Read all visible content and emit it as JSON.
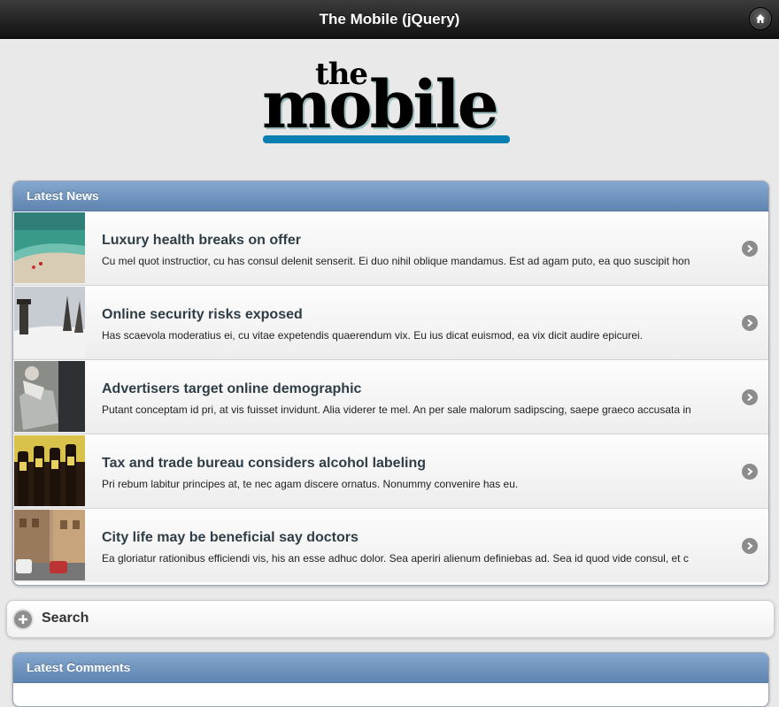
{
  "header": {
    "title": "The Mobile (jQuery)",
    "home_icon": "home-icon"
  },
  "logo": {
    "the": "the",
    "mobile": "mobile",
    "accent": "#0a7fb2"
  },
  "latest_news": {
    "heading": "Latest News",
    "items": [
      {
        "title": "Luxury health breaks on offer",
        "desc": "Cu mel quot instructior, cu has consul delenit senserit. Ei duo nihil oblique mandamus. Est ad agam puto, ea quo suscipit hon",
        "thumb": "beach-thumbnail"
      },
      {
        "title": "Online security risks exposed",
        "desc": "Has scaevola moderatius ei, cu vitae expetendis quaerendum vix. Eu ius dicat euismod, ea vix dicit audire epicurei.",
        "thumb": "snow-tower-thumbnail"
      },
      {
        "title": "Advertisers target online demographic",
        "desc": "Putant conceptam id pri, at vis fuisset invidunt. Alia viderer te mel. An per sale malorum sadipscing, saepe graeco accusata in",
        "thumb": "sofa-thumbnail"
      },
      {
        "title": "Tax and trade bureau considers alcohol labeling",
        "desc": "Pri rebum labitur principes at, te nec agam discere ornatus. Nonummy convenire has eu.",
        "thumb": "bottles-thumbnail"
      },
      {
        "title": "City life may be beneficial say doctors",
        "desc": "Ea gloriatur rationibus efficiendi vis, his an esse adhuc dolor. Sea aperiri alienum definiebas ad. Sea id quod vide consul, et c",
        "thumb": "street-thumbnail"
      }
    ]
  },
  "search": {
    "label": "Search",
    "icon": "plus-icon"
  },
  "latest_comments": {
    "heading": "Latest Comments"
  },
  "colors": {
    "header_bg": "#1a1a1a",
    "panel_head": "#6d90ba",
    "page_bg": "#e9e9e9"
  }
}
